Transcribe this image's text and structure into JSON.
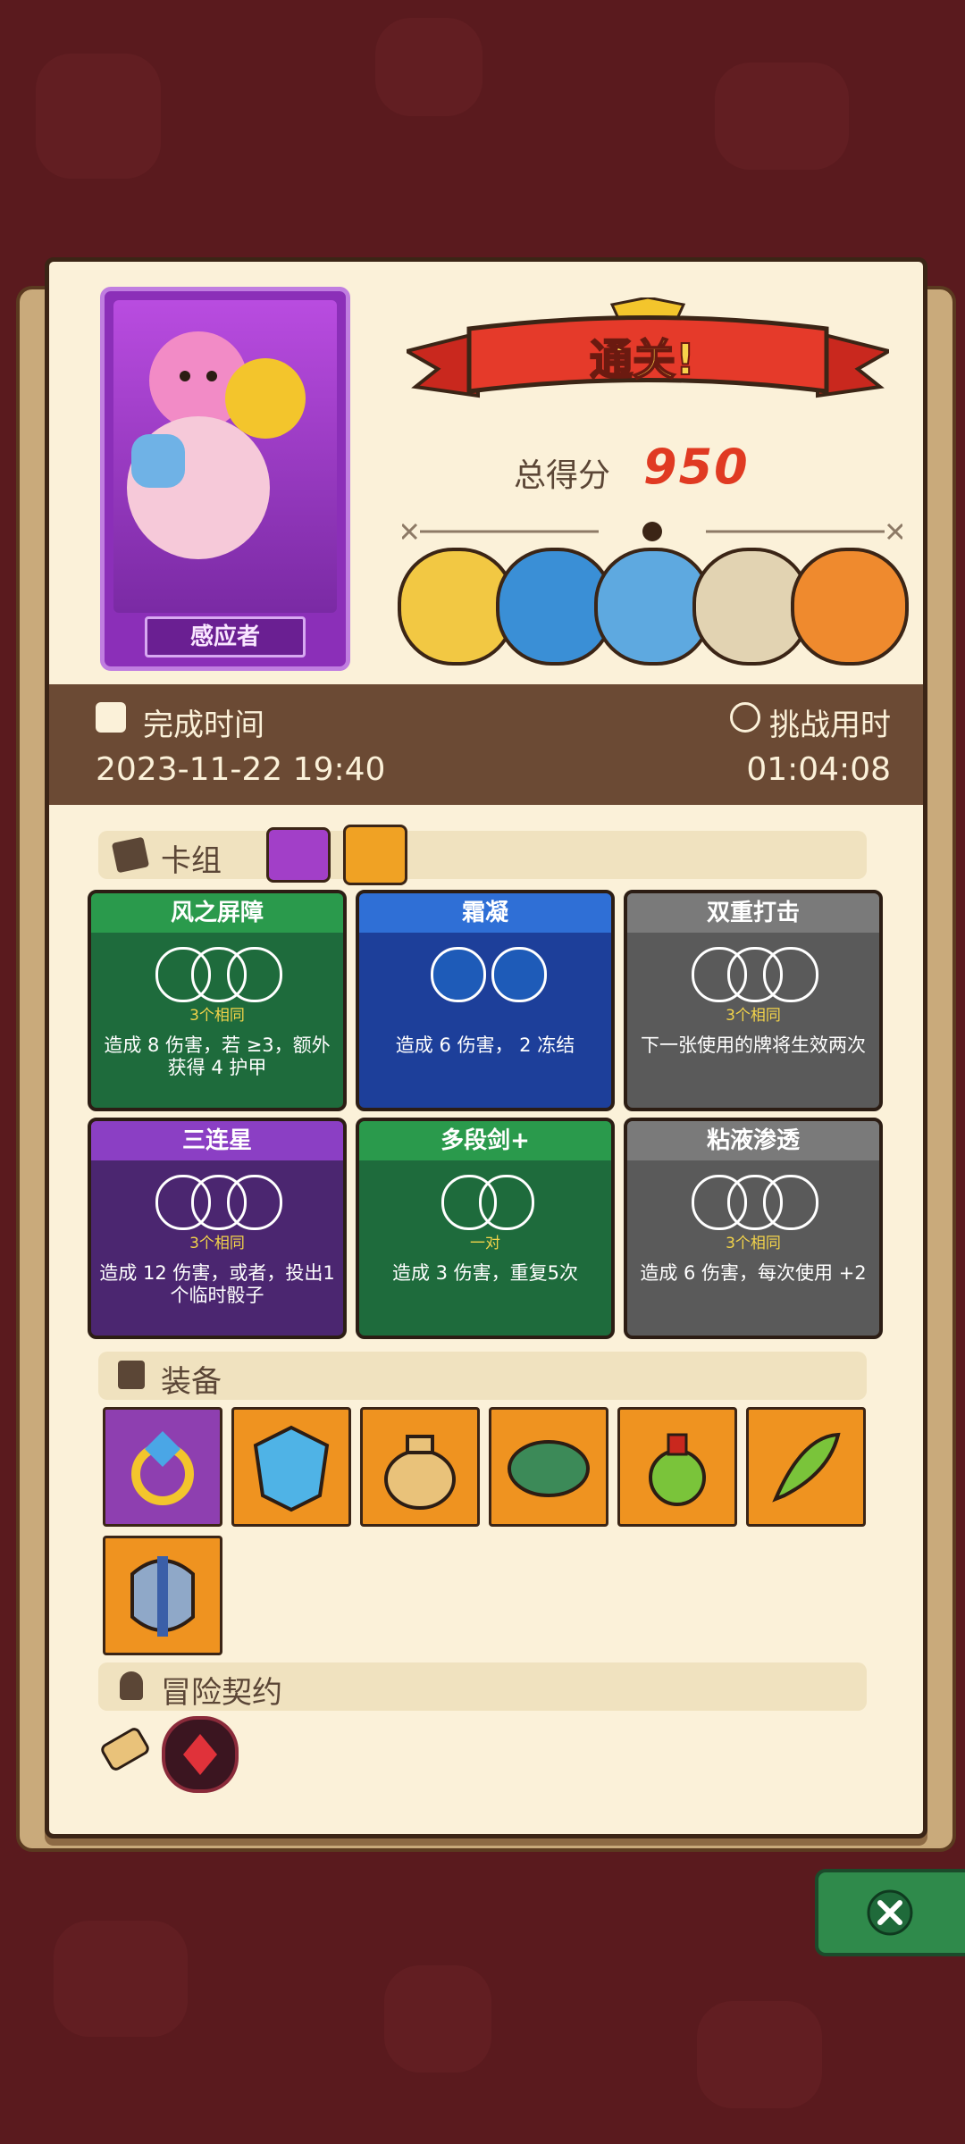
{
  "banner": {
    "title": "通关!"
  },
  "score": {
    "label": "总得分",
    "value": "950"
  },
  "character": {
    "name": "感应者"
  },
  "times": {
    "complete_label": "完成时间",
    "complete_value": "2023-11-22 19:40",
    "challenge_label": "挑战用时",
    "challenge_value": "01:04:08"
  },
  "sections": {
    "deck": "卡组",
    "equipment": "装备",
    "contract": "冒险契约"
  },
  "cards": [
    {
      "title": "风之屏障",
      "sub": "3个相同",
      "desc": "造成 8 伤害，若 ≥3，额外获得 4 护甲"
    },
    {
      "title": "霜凝",
      "sub": "",
      "desc": "造成 6 伤害， 2 冻结"
    },
    {
      "title": "双重打击",
      "sub": "3个相同",
      "desc": "下一张使用的牌将生效两次"
    },
    {
      "title": "三连星",
      "sub": "3个相同",
      "desc": "造成 12 伤害，或者，投出1个临时骰子"
    },
    {
      "title": "多段剑+",
      "sub": "一对",
      "desc": "造成 3 伤害，重复5次"
    },
    {
      "title": "粘液渗透",
      "sub": "3个相同",
      "desc": "造成 6 伤害，每次使用 +2"
    }
  ],
  "colors": {
    "accent": "#e03a22",
    "panel": "#fbf1d9",
    "bar": "#6b4a34"
  }
}
